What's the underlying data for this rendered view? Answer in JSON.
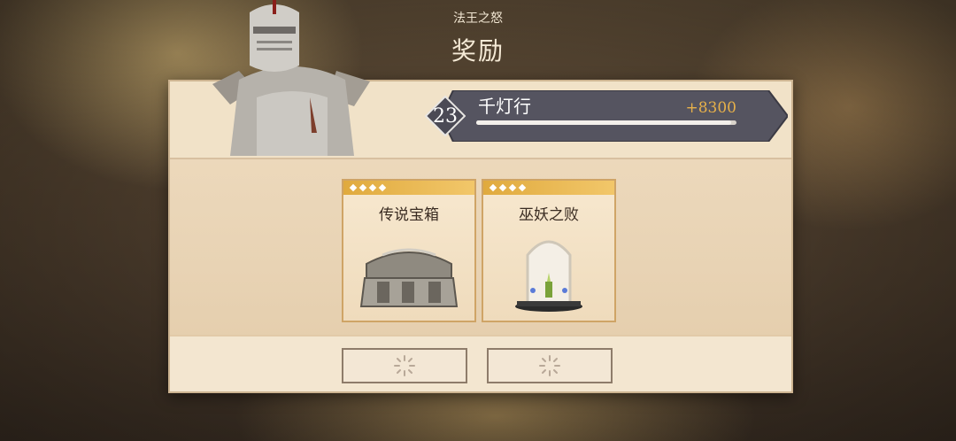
{
  "event": {
    "title": "法王之怒"
  },
  "screen": {
    "title": "奖励"
  },
  "player": {
    "level": "23",
    "name": "千灯行",
    "score": "+8300",
    "progress_fraction": 0.98
  },
  "rewards": [
    {
      "label": "传说宝箱",
      "stars": 4,
      "icon": "treasure-chest-icon"
    },
    {
      "label": "巫妖之败",
      "stars": 4,
      "icon": "lich-shrine-icon"
    }
  ],
  "buttons": [
    {
      "state": "loading",
      "icon": "loading-spinner-icon"
    },
    {
      "state": "loading",
      "icon": "loading-spinner-icon"
    }
  ],
  "colors": {
    "accent_gold": "#e7b14a",
    "ribbon_gold": "#e0aa3e",
    "banner_gray": "#555460"
  }
}
